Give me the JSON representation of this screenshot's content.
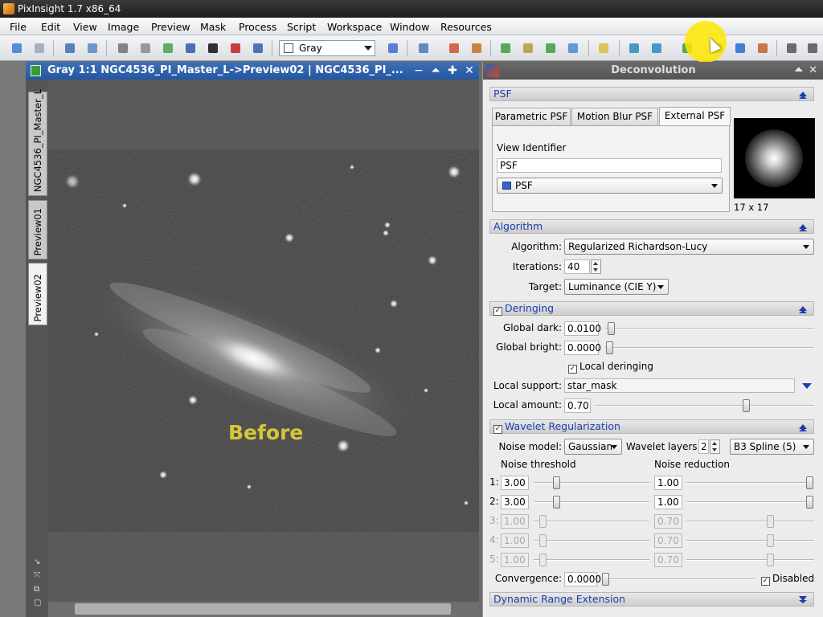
{
  "app": {
    "title": "PixInsight 1.7 x86_64"
  },
  "menu": [
    "File",
    "Edit",
    "View",
    "Image",
    "Preview",
    "Mask",
    "Process",
    "Script",
    "Workspace",
    "Window",
    "Resources"
  ],
  "toolbar": {
    "color_mode": "Gray"
  },
  "image_window": {
    "title": "Gray 1:1 NGC4536_PI_Master_L->Preview02 | NGC4536_PI_...",
    "tabs": [
      "NGC4536_PI_Master_L",
      "Preview01",
      "Preview02"
    ],
    "overlay_label": "Before",
    "buttons": {
      "minimize": "−",
      "shade": "⏶",
      "maximize": "✚",
      "close": "✕"
    }
  },
  "process": {
    "title": "Deconvolution",
    "psf": {
      "section": "PSF",
      "tabs": [
        "Parametric PSF",
        "Motion Blur PSF",
        "External PSF"
      ],
      "view_identifier_label": "View Identifier",
      "view_identifier_value": "PSF",
      "view_selector": "PSF",
      "psf_size": "17 x 17"
    },
    "algorithm": {
      "section": "Algorithm",
      "algorithm_label": "Algorithm:",
      "algorithm_value": "Regularized Richardson-Lucy",
      "iterations_label": "Iterations:",
      "iterations_value": "40",
      "target_label": "Target:",
      "target_value": "Luminance (CIE Y)"
    },
    "deringing": {
      "section": "Deringing",
      "global_dark_label": "Global dark:",
      "global_dark_value": "0.0100",
      "global_bright_label": "Global bright:",
      "global_bright_value": "0.0000",
      "local_deringing_label": "Local deringing",
      "local_support_label": "Local support:",
      "local_support_value": "star_mask",
      "local_amount_label": "Local amount:",
      "local_amount_value": "0.70"
    },
    "wavelet": {
      "section": "Wavelet Regularization",
      "noise_model_label": "Noise model:",
      "noise_model_value": "Gaussian",
      "wavelet_layers_label": "Wavelet layers:",
      "wavelet_layers_value": "2",
      "scaling_function": "B3 Spline (5)",
      "noise_threshold_header": "Noise threshold",
      "noise_reduction_header": "Noise reduction",
      "layers": [
        {
          "n": "1:",
          "threshold": "3.00",
          "reduction": "1.00"
        },
        {
          "n": "2:",
          "threshold": "3.00",
          "reduction": "1.00"
        },
        {
          "n": "3:",
          "threshold": "1.00",
          "reduction": "0.70"
        },
        {
          "n": "4:",
          "threshold": "1.00",
          "reduction": "0.70"
        },
        {
          "n": "5:",
          "threshold": "1.00",
          "reduction": "0.70"
        }
      ],
      "convergence_label": "Convergence:",
      "convergence_value": "0.0000",
      "disabled_label": "Disabled"
    },
    "dynamic_range": {
      "section": "Dynamic Range Extension"
    }
  }
}
